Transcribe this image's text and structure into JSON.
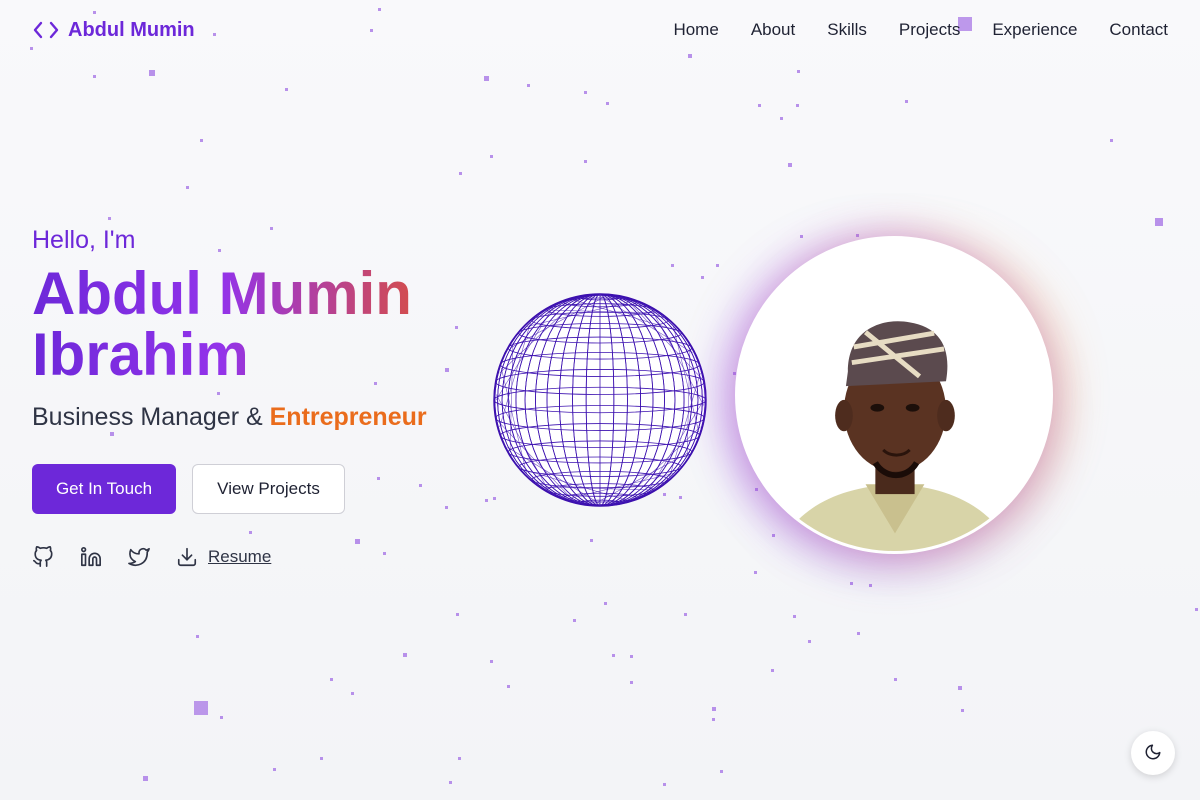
{
  "brand": {
    "name": "Abdul Mumin",
    "icon": "code-icon",
    "color": "#6d28d9"
  },
  "nav": {
    "items": [
      "Home",
      "About",
      "Skills",
      "Projects",
      "Experience",
      "Contact"
    ]
  },
  "hero": {
    "greeting": "Hello, I'm",
    "name_line1": "Abdul Mumin",
    "name_line2": "Ibrahim",
    "role_prefix": "Business Manager & ",
    "role_accent": "Entrepreneur",
    "primary_button": "Get In Touch",
    "secondary_button": "View Projects"
  },
  "socials": {
    "github_icon": "github-icon",
    "linkedin_icon": "linkedin-icon",
    "twitter_icon": "twitter-icon",
    "resume_icon": "download-icon",
    "resume_label": "Resume"
  },
  "theme": {
    "toggle_icon": "moon-icon"
  },
  "colors": {
    "accent": "#6d28d9",
    "gradient_end": "#e0522e",
    "highlight": "#ea6c1c",
    "particles": "#a877e6"
  }
}
